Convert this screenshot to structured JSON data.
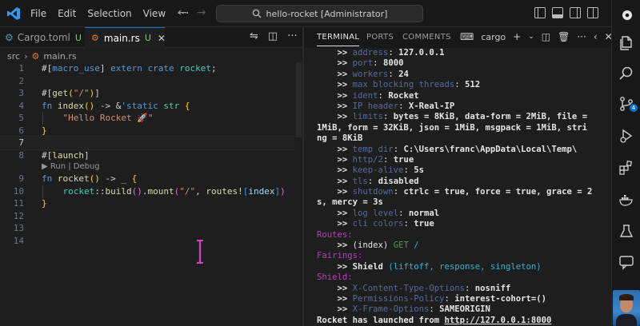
{
  "titlebar": {
    "menu": [
      "File",
      "Edit",
      "Selection",
      "View"
    ],
    "more": "···",
    "command_center": "hello-rocket [Administrator]"
  },
  "editor": {
    "tabs": [
      {
        "label": "Cargo.toml",
        "status": "U"
      },
      {
        "label": "main.rs",
        "status": "U"
      }
    ],
    "breadcrumb": {
      "folder": "src",
      "file": "main.rs"
    },
    "codelens": "▶ Run | Debug",
    "line_numbers": [
      "1",
      "2",
      "3",
      "4",
      "5",
      "6",
      "7",
      "8",
      "9",
      "10",
      "11",
      "12",
      "13",
      "14"
    ]
  },
  "terminal": {
    "tabs": [
      "TERMINAL",
      "PORTS",
      "COMMENTS"
    ],
    "shell": "cargo",
    "lines": [
      {
        "type": "cfg",
        "key": "address",
        "value": "127.0.0.1"
      },
      {
        "type": "cfg",
        "key": "port",
        "value": "8000"
      },
      {
        "type": "cfg",
        "key": "workers",
        "value": "24"
      },
      {
        "type": "cfg",
        "key": "max blocking threads",
        "value": "512"
      },
      {
        "type": "cfg",
        "key": "ident",
        "value": "Rocket"
      },
      {
        "type": "cfg",
        "key": "IP header",
        "value": "X-Real-IP"
      },
      {
        "type": "cfg",
        "key": "limits",
        "value": "bytes = 8KiB, data-form = 2MiB, file ="
      },
      {
        "type": "raw",
        "text": "1MiB, form = 32KiB, json = 1MiB, msgpack = 1MiB, stri"
      },
      {
        "type": "raw",
        "text": "ng = 8KiB"
      },
      {
        "type": "cfg",
        "key": "temp dir",
        "value": "C:\\Users\\franc\\AppData\\Local\\Temp\\"
      },
      {
        "type": "cfg",
        "key": "http/2",
        "value": "true"
      },
      {
        "type": "cfg",
        "key": "keep-alive",
        "value": "5s"
      },
      {
        "type": "cfg",
        "key": "tls",
        "value": "disabled"
      },
      {
        "type": "cfg",
        "key": "shutdown",
        "value": "ctrlc = true, force = true, grace = 2"
      },
      {
        "type": "raw",
        "text": "s, mercy = 3s"
      },
      {
        "type": "cfg",
        "key": "log level",
        "value": "normal"
      },
      {
        "type": "cfg",
        "key": "cli colors",
        "value": "true"
      },
      {
        "type": "section",
        "text": "Routes:"
      },
      {
        "type": "route",
        "handler": "(index)",
        "method": "GET",
        "path": "/"
      },
      {
        "type": "section",
        "text": "Fairings:"
      },
      {
        "type": "fairing",
        "name": "Shield",
        "kinds": "(liftoff, response, singleton)"
      },
      {
        "type": "section",
        "text": "Shield:"
      },
      {
        "type": "cfg",
        "key": "X-Content-Type-Options",
        "value": "nosniff"
      },
      {
        "type": "cfg",
        "key": "Permissions-Policy",
        "value": "interest-cohort=()"
      },
      {
        "type": "cfg",
        "key": "X-Frame-Options",
        "value": "SAMEORIGIN"
      },
      {
        "type": "launch",
        "text": "Rocket has launched from ",
        "url": "http://127.0.0.1:8000"
      }
    ]
  },
  "activity_bar": {
    "source_control_badge": "4"
  },
  "colors": {
    "accent": "#0078d4",
    "editor_bg": "#1e1e1e",
    "chrome_bg": "#181818"
  }
}
